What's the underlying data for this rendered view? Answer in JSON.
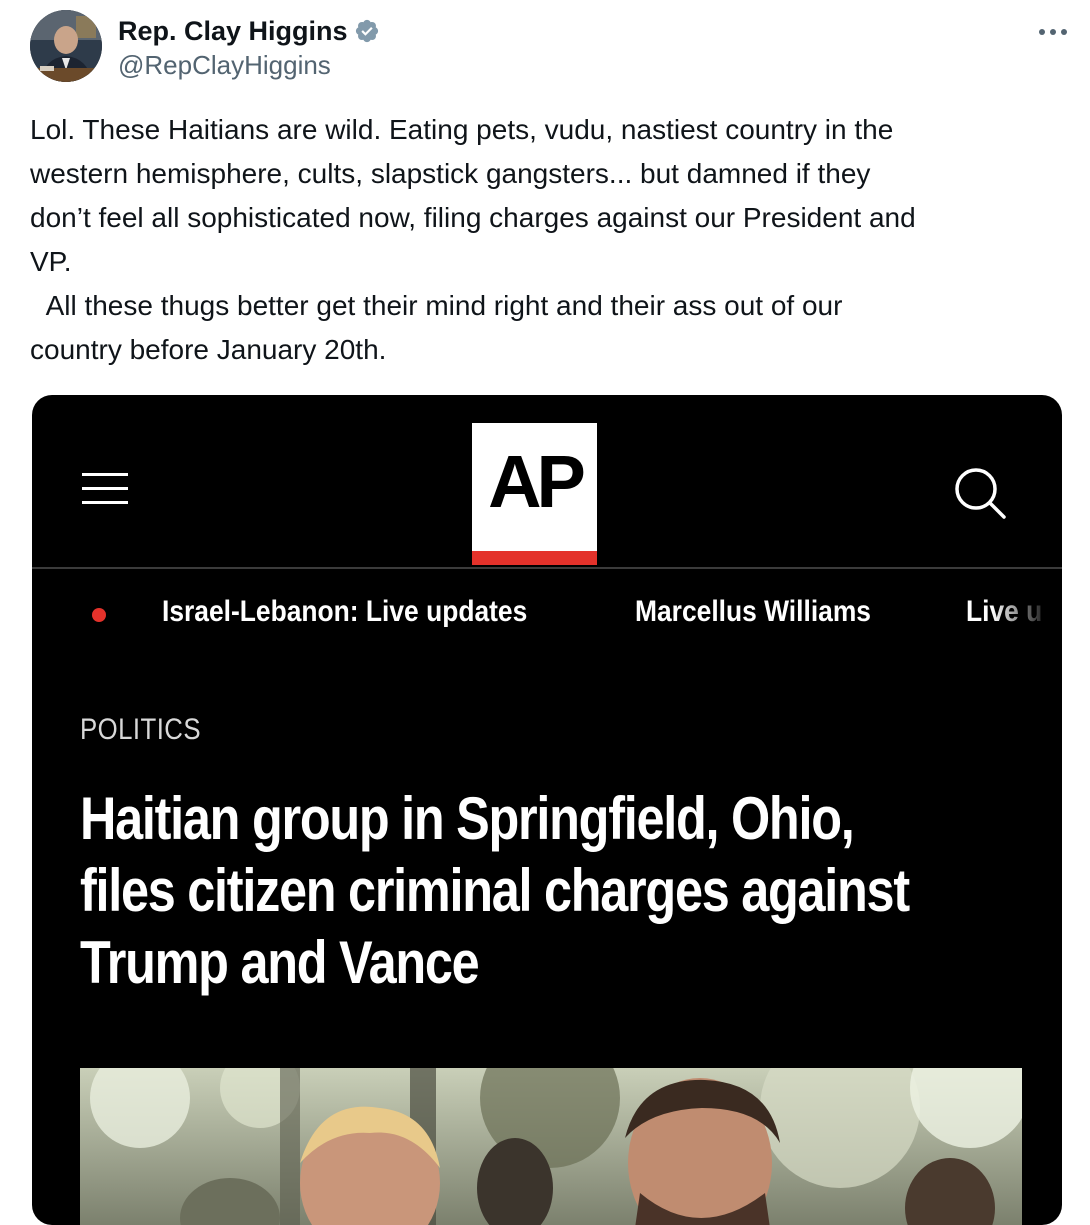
{
  "author": {
    "name": "Rep. Clay Higgins",
    "handle": "@RepClayHiggins",
    "verified_color": "#829aab"
  },
  "tweet": {
    "text": "Lol. These Haitians are wild. Eating pets, vudu, nastiest country in the\nwestern hemisphere, cults, slapstick gangsters... but damned if they\ndon’t feel all sophisticated now, filing charges against our President and\nVP.\n  All these thugs better get their mind right and their ass out of our\ncountry before January 20th."
  },
  "icons": {
    "more": "more-horizontal-icon",
    "verified": "verified-badge-icon",
    "menu": "hamburger-menu-icon",
    "search": "search-icon"
  },
  "embed": {
    "logo_text": "AP",
    "logo_accent": "#e4322b",
    "ticker": [
      "Israel-Lebanon: Live updates",
      "Marcellus Williams",
      "Live u"
    ],
    "section": "POLITICS",
    "headline": "Haitian group in Springfield, Ohio,\nfiles citizen criminal charges against\nTrump and Vance"
  }
}
